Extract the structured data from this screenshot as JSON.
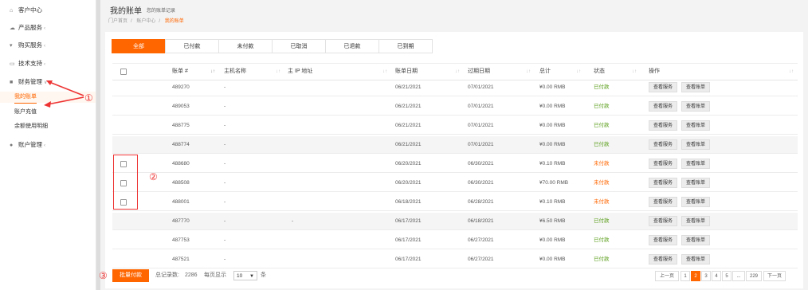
{
  "sidebar": {
    "items": [
      {
        "icon": "home-icon",
        "label": "客户中心",
        "chevron": ""
      },
      {
        "icon": "cloud-icon",
        "label": "产品服务",
        "chevron": "‹"
      },
      {
        "icon": "cart-icon",
        "label": "购买服务",
        "chevron": "‹"
      },
      {
        "icon": "monitor-icon",
        "label": "技术支持",
        "chevron": "‹"
      },
      {
        "icon": "briefcase-icon",
        "label": "财务管理",
        "chevron": "∨"
      },
      {
        "icon": "user-icon",
        "label": "账户管理",
        "chevron": "‹"
      }
    ],
    "sub_items": [
      "我的账单",
      "账户充值",
      "余额使用明细"
    ]
  },
  "header": {
    "title": "我的账单",
    "subtitle": "您的账单记录",
    "breadcrumb": [
      "门户首页",
      "账户中心",
      "我的账单"
    ],
    "separators": [
      "/",
      "/"
    ]
  },
  "tabs": [
    "全部",
    "已付款",
    "未付款",
    "已取消",
    "已退款",
    "已到期"
  ],
  "table": {
    "columns": [
      "账单 #",
      "主机名称",
      "主 IP 地址",
      "账单日期",
      "过期日期",
      "总计",
      "状态",
      "操作"
    ],
    "rows": [
      {
        "id": "489270",
        "host": "-",
        "ip": "",
        "bill_date": "06/21/2021",
        "due_date": "07/01/2021",
        "total": "¥0.00 RMB",
        "status": "已付款",
        "status_type": "paid",
        "checkbox": false
      },
      {
        "id": "489053",
        "host": "-",
        "ip": "",
        "bill_date": "06/21/2021",
        "due_date": "07/01/2021",
        "total": "¥0.00 RMB",
        "status": "已付款",
        "status_type": "paid",
        "checkbox": false
      },
      {
        "id": "488775",
        "host": "-",
        "ip": "",
        "bill_date": "06/21/2021",
        "due_date": "07/01/2021",
        "total": "¥0.00 RMB",
        "status": "已付款",
        "status_type": "paid",
        "checkbox": false
      },
      {
        "id": "488774",
        "host": "-",
        "ip": "",
        "bill_date": "06/21/2021",
        "due_date": "07/01/2021",
        "total": "¥0.00 RMB",
        "status": "已付款",
        "status_type": "paid",
        "checkbox": false
      },
      {
        "id": "488680",
        "host": "-",
        "ip": "",
        "bill_date": "06/20/2021",
        "due_date": "06/30/2021",
        "total": "¥0.10 RMB",
        "status": "未付款",
        "status_type": "unpaid",
        "checkbox": true
      },
      {
        "id": "488508",
        "host": "-",
        "ip": "",
        "bill_date": "06/20/2021",
        "due_date": "06/30/2021",
        "total": "¥70.00 RMB",
        "status": "未付款",
        "status_type": "unpaid",
        "checkbox": true
      },
      {
        "id": "488001",
        "host": "-",
        "ip": "",
        "bill_date": "06/18/2021",
        "due_date": "06/28/2021",
        "total": "¥0.10 RMB",
        "status": "未付款",
        "status_type": "unpaid",
        "checkbox": true
      },
      {
        "id": "487770",
        "host": "-",
        "ip": "-",
        "bill_date": "06/17/2021",
        "due_date": "06/18/2021",
        "total": "¥6.50 RMB",
        "status": "已付款",
        "status_type": "paid",
        "checkbox": false
      },
      {
        "id": "487753",
        "host": "-",
        "ip": "",
        "bill_date": "06/17/2021",
        "due_date": "06/27/2021",
        "total": "¥0.00 RMB",
        "status": "已付款",
        "status_type": "paid",
        "checkbox": false
      },
      {
        "id": "487521",
        "host": "-",
        "ip": "",
        "bill_date": "06/17/2021",
        "due_date": "06/27/2021",
        "total": "¥0.00 RMB",
        "status": "已付款",
        "status_type": "paid",
        "checkbox": false
      }
    ],
    "action_view": "查看服务",
    "action_bill": "查看账单"
  },
  "footer": {
    "bulk_pay": "批量付款",
    "total_label": "总记录数:",
    "total_count": "2286",
    "per_page_label": "每页显示",
    "per_page": "10",
    "unit": "条"
  },
  "pagination": [
    "上一页",
    "1",
    "2",
    "3",
    "4",
    "5",
    "...",
    "229",
    "下一页"
  ],
  "annotations": [
    "①",
    "②",
    "③"
  ],
  "colors": {
    "accent": "#ff6600",
    "paid": "#5a9e1a",
    "annotation": "#e33333"
  }
}
